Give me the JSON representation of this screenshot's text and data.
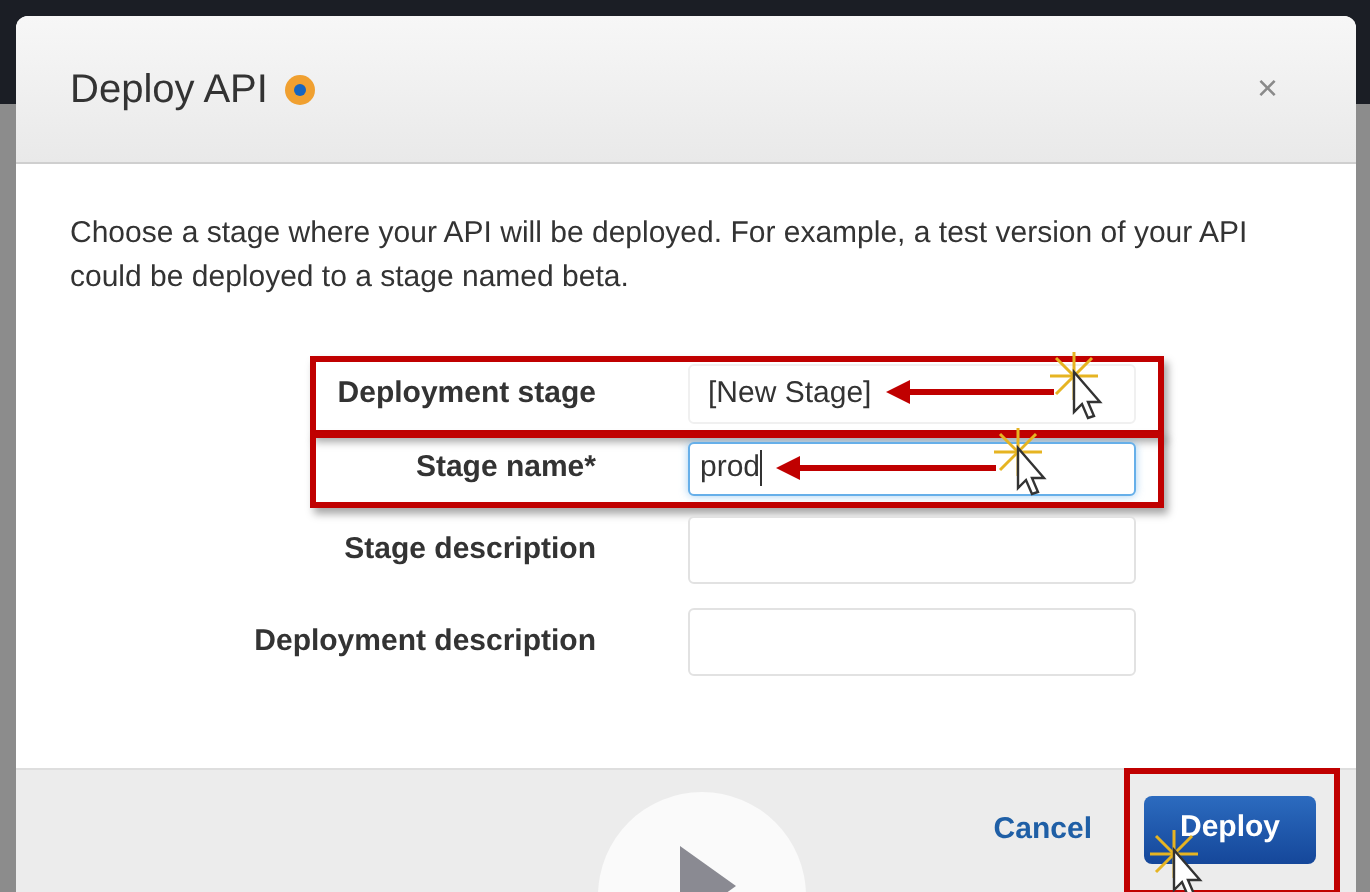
{
  "dialog": {
    "title": "Deploy API",
    "close": "×",
    "description": "Choose a stage where your API will be deployed. For example, a test version of your API could be deployed to a stage named beta.",
    "fields": [
      {
        "kind": "select",
        "label": "Deployment stage",
        "value": "[New Stage]",
        "highlighted": true,
        "focused": false
      },
      {
        "kind": "input",
        "label": "Stage name*",
        "value": "prod",
        "highlighted": true,
        "focused": true
      },
      {
        "kind": "textarea",
        "label": "Stage description",
        "highlighted": false,
        "focused": false
      },
      {
        "kind": "textarea",
        "label": "Deployment description",
        "highlighted": false,
        "focused": false
      }
    ],
    "buttons": [
      {
        "kind": "link",
        "label": "Cancel"
      },
      {
        "kind": "primary",
        "label": "Deploy",
        "highlighted": true
      }
    ]
  }
}
